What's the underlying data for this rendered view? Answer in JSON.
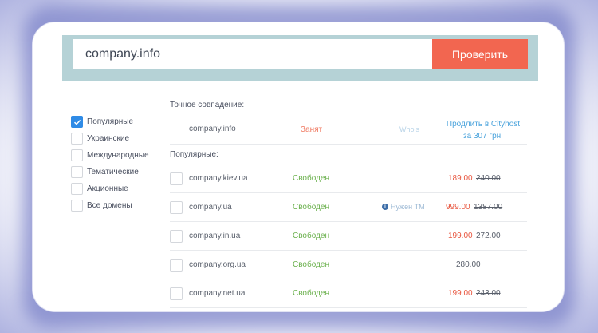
{
  "search": {
    "value": "company.info",
    "button_label": "Проверить"
  },
  "filters": [
    {
      "label": "Популярные",
      "checked": true
    },
    {
      "label": "Украинские",
      "checked": false
    },
    {
      "label": "Международные",
      "checked": false
    },
    {
      "label": "Тематические",
      "checked": false
    },
    {
      "label": "Акционные",
      "checked": false
    },
    {
      "label": "Все домены",
      "checked": false
    }
  ],
  "exact": {
    "label": "Точное совпадение:",
    "domain": "company.info",
    "status": "Занят",
    "whois": "Whois",
    "renew_line1": "Продлить в Cityhost",
    "renew_line2": "за 307 грн."
  },
  "popular_label": "Популярные:",
  "rows": [
    {
      "domain": "company.kiev.ua",
      "status": "Свободен",
      "note": "",
      "price": "189.00",
      "old_price": "240.00"
    },
    {
      "domain": "company.ua",
      "status": "Свободен",
      "note": "Нужен ТМ",
      "price": "999.00",
      "old_price": "1387.00"
    },
    {
      "domain": "company.in.ua",
      "status": "Свободен",
      "note": "",
      "price": "199.00",
      "old_price": "272.00"
    },
    {
      "domain": "company.org.ua",
      "status": "Свободен",
      "note": "",
      "price": "280.00",
      "old_price": ""
    },
    {
      "domain": "company.net.ua",
      "status": "Свободен",
      "note": "",
      "price": "199.00",
      "old_price": "243.00"
    }
  ],
  "colors": {
    "accent_button": "#f26650",
    "search_band": "#b5d2d6",
    "free_status": "#6ab04c",
    "taken_status": "#f07a62",
    "checkbox_checked": "#2f8be6"
  }
}
